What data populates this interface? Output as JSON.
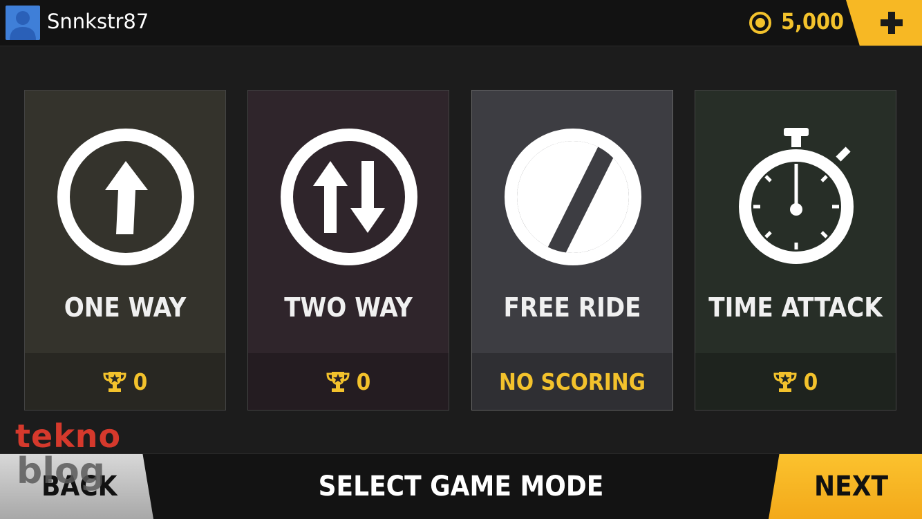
{
  "header": {
    "username": "Snnkstr87",
    "coins": "5,000"
  },
  "modes": [
    {
      "title": "ONE WAY",
      "score": "0",
      "icon": "one-way-arrow-icon"
    },
    {
      "title": "TWO WAY",
      "score": "0",
      "icon": "two-way-arrows-icon"
    },
    {
      "title": "FREE RIDE",
      "score": "NO SCORING",
      "icon": "no-limit-sign-icon"
    },
    {
      "title": "TIME ATTACK",
      "score": "0",
      "icon": "stopwatch-icon"
    }
  ],
  "footer": {
    "back_label": "BACK",
    "title": "SELECT GAME MODE",
    "next_label": "NEXT"
  },
  "watermark": {
    "line1": "tekno",
    "line2": "blog"
  },
  "colors": {
    "accent": "#f7b824",
    "score": "#f3c22c",
    "card_one_way": "#34332c",
    "card_two_way": "#2f252b",
    "card_free_ride": "#3d3d42",
    "card_time_attack": "#272e27"
  }
}
